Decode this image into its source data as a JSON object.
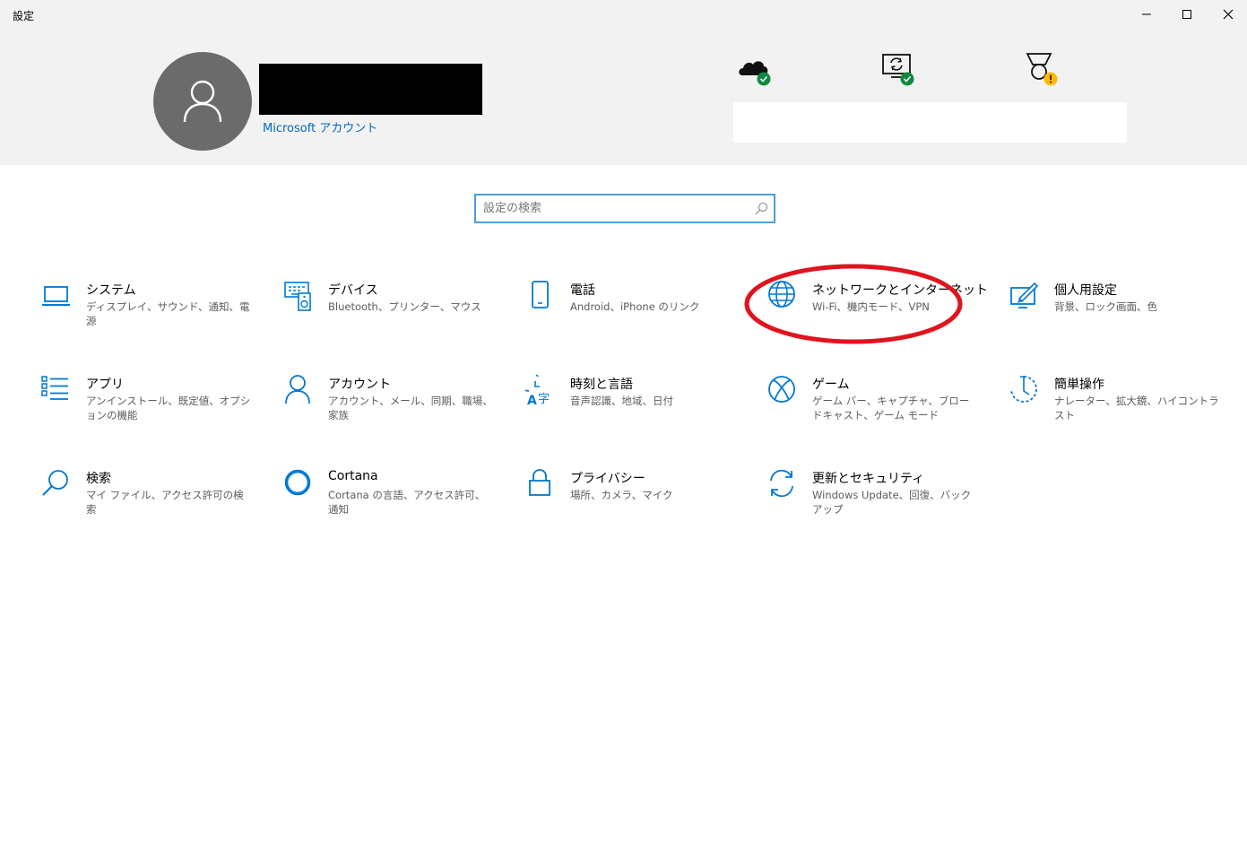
{
  "window": {
    "title": "設定",
    "controls": [
      "minimize-icon",
      "maximize-icon",
      "close-icon"
    ]
  },
  "account": {
    "link": "Microsoft アカウント",
    "name_redacted": true
  },
  "status_icons": [
    {
      "icon": "onedrive-cloud-icon",
      "badge": "check"
    },
    {
      "icon": "pc-sync-icon",
      "badge": "check"
    },
    {
      "icon": "rewards-medal-icon",
      "badge": "warning"
    }
  ],
  "search": {
    "placeholder": "設定の検索"
  },
  "tiles": [
    {
      "id": "system",
      "title": "システム",
      "subtitle": "ディスプレイ、サウンド、通知、電源",
      "icon": "laptop-icon"
    },
    {
      "id": "devices",
      "title": "デバイス",
      "subtitle": "Bluetooth、プリンター、マウス",
      "icon": "keyboard-speaker-icon"
    },
    {
      "id": "phone",
      "title": "電話",
      "subtitle": "Android、iPhone のリンク",
      "icon": "phone-icon"
    },
    {
      "id": "network",
      "title": "ネットワークとインターネット",
      "subtitle": "Wi-Fi、機内モード、VPN",
      "icon": "globe-icon"
    },
    {
      "id": "personalization",
      "title": "個人用設定",
      "subtitle": "背景、ロック画面、色",
      "icon": "personalization-icon"
    },
    {
      "id": "apps",
      "title": "アプリ",
      "subtitle": "アンインストール、既定値、オプションの機能",
      "icon": "apps-list-icon"
    },
    {
      "id": "accounts",
      "title": "アカウント",
      "subtitle": "アカウント、メール、同期、職場、家族",
      "icon": "person-icon"
    },
    {
      "id": "time-language",
      "title": "時刻と言語",
      "subtitle": "音声認識、地域、日付",
      "icon": "time-language-icon"
    },
    {
      "id": "gaming",
      "title": "ゲーム",
      "subtitle": "ゲーム バー、キャプチャ、ブロードキャスト、ゲーム モード",
      "icon": "xbox-icon"
    },
    {
      "id": "ease-of-access",
      "title": "簡単操作",
      "subtitle": "ナレーター、拡大鏡、ハイコントラスト",
      "icon": "ease-of-access-icon"
    },
    {
      "id": "search",
      "title": "検索",
      "subtitle": "マイ ファイル、アクセス許可の検索",
      "icon": "search-icon"
    },
    {
      "id": "cortana",
      "title": "Cortana",
      "subtitle": "Cortana の言語、アクセス許可、通知",
      "icon": "cortana-icon"
    },
    {
      "id": "privacy",
      "title": "プライバシー",
      "subtitle": "場所、カメラ、マイク",
      "icon": "lock-icon"
    },
    {
      "id": "update-security",
      "title": "更新とセキュリティ",
      "subtitle": "Windows Update、回復、バックアップ",
      "icon": "update-sync-icon"
    }
  ],
  "highlight": {
    "target": "network",
    "color": "#e0141e"
  },
  "colors": {
    "accent": "#0067c0",
    "icon_blue": "#0078d4",
    "header_bg": "#f2f2f2",
    "ok_badge": "#10893e",
    "warn_badge": "#ffb900"
  }
}
